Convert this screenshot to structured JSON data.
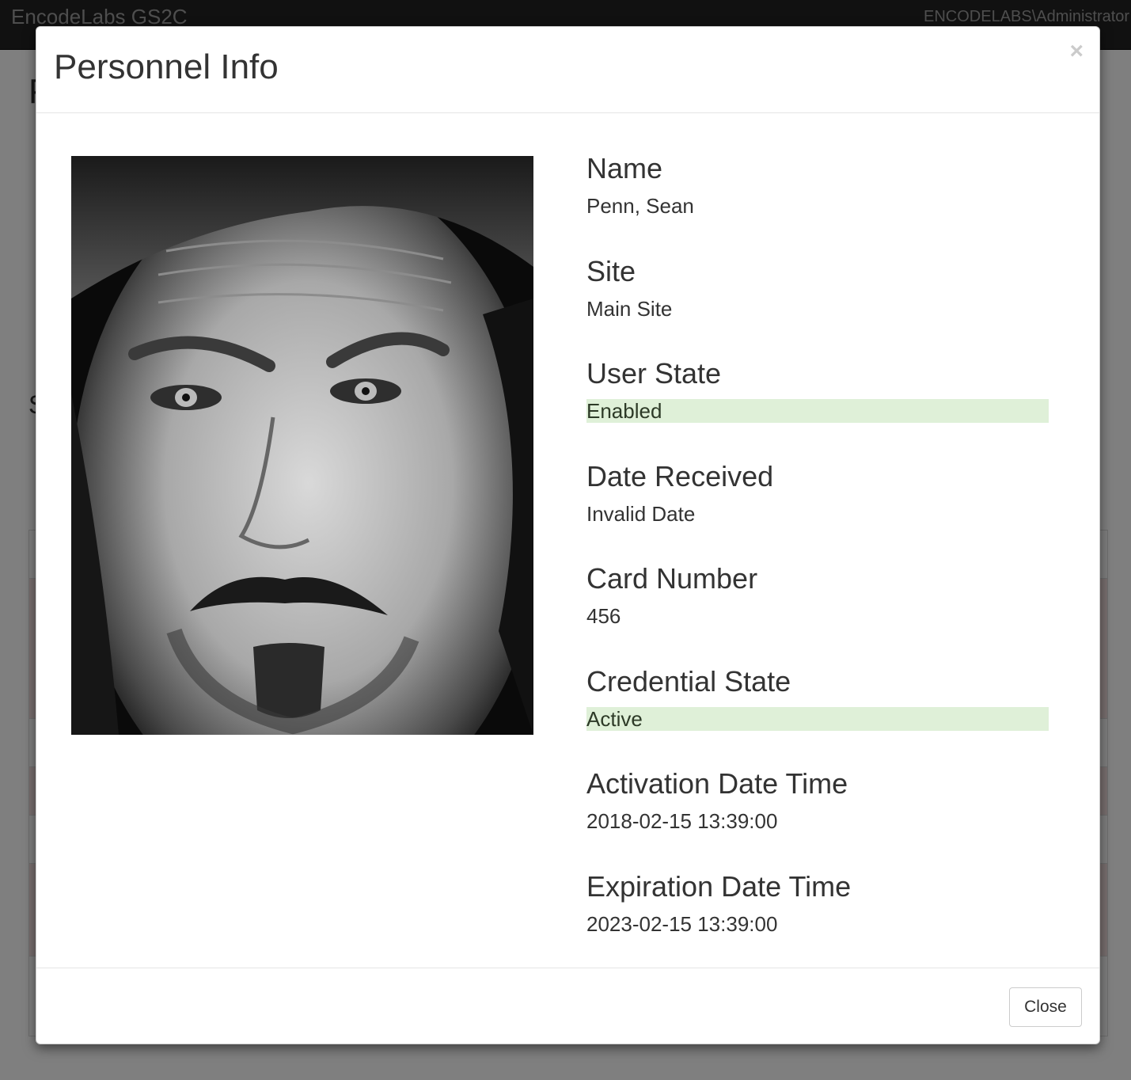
{
  "navbar": {
    "brand": "EncodeLabs GS2C",
    "user": "ENCODELABS\\Administrator"
  },
  "background": {
    "heading": "P",
    "subheading": "S"
  },
  "modal": {
    "title": "Personnel Info",
    "close_symbol": "×",
    "photo_alt": "Personnel photo",
    "fields": [
      {
        "label": "Name",
        "value": "Penn, Sean",
        "status": ""
      },
      {
        "label": "Site",
        "value": "Main Site",
        "status": ""
      },
      {
        "label": "User State",
        "value": "Enabled",
        "status": "success"
      },
      {
        "label": "Date Received",
        "value": "Invalid Date",
        "status": ""
      },
      {
        "label": "Card Number",
        "value": "456",
        "status": ""
      },
      {
        "label": "Credential State",
        "value": "Active",
        "status": "success"
      },
      {
        "label": "Activation Date Time",
        "value": "2018-02-15 13:39:00",
        "status": ""
      },
      {
        "label": "Expiration Date Time",
        "value": "2023-02-15 13:39:00",
        "status": ""
      }
    ],
    "footer": {
      "close_label": "Close"
    }
  },
  "colors": {
    "navbar_bg": "#222222",
    "success_bg": "#dff0d8",
    "row_danger": "#f2dede"
  }
}
